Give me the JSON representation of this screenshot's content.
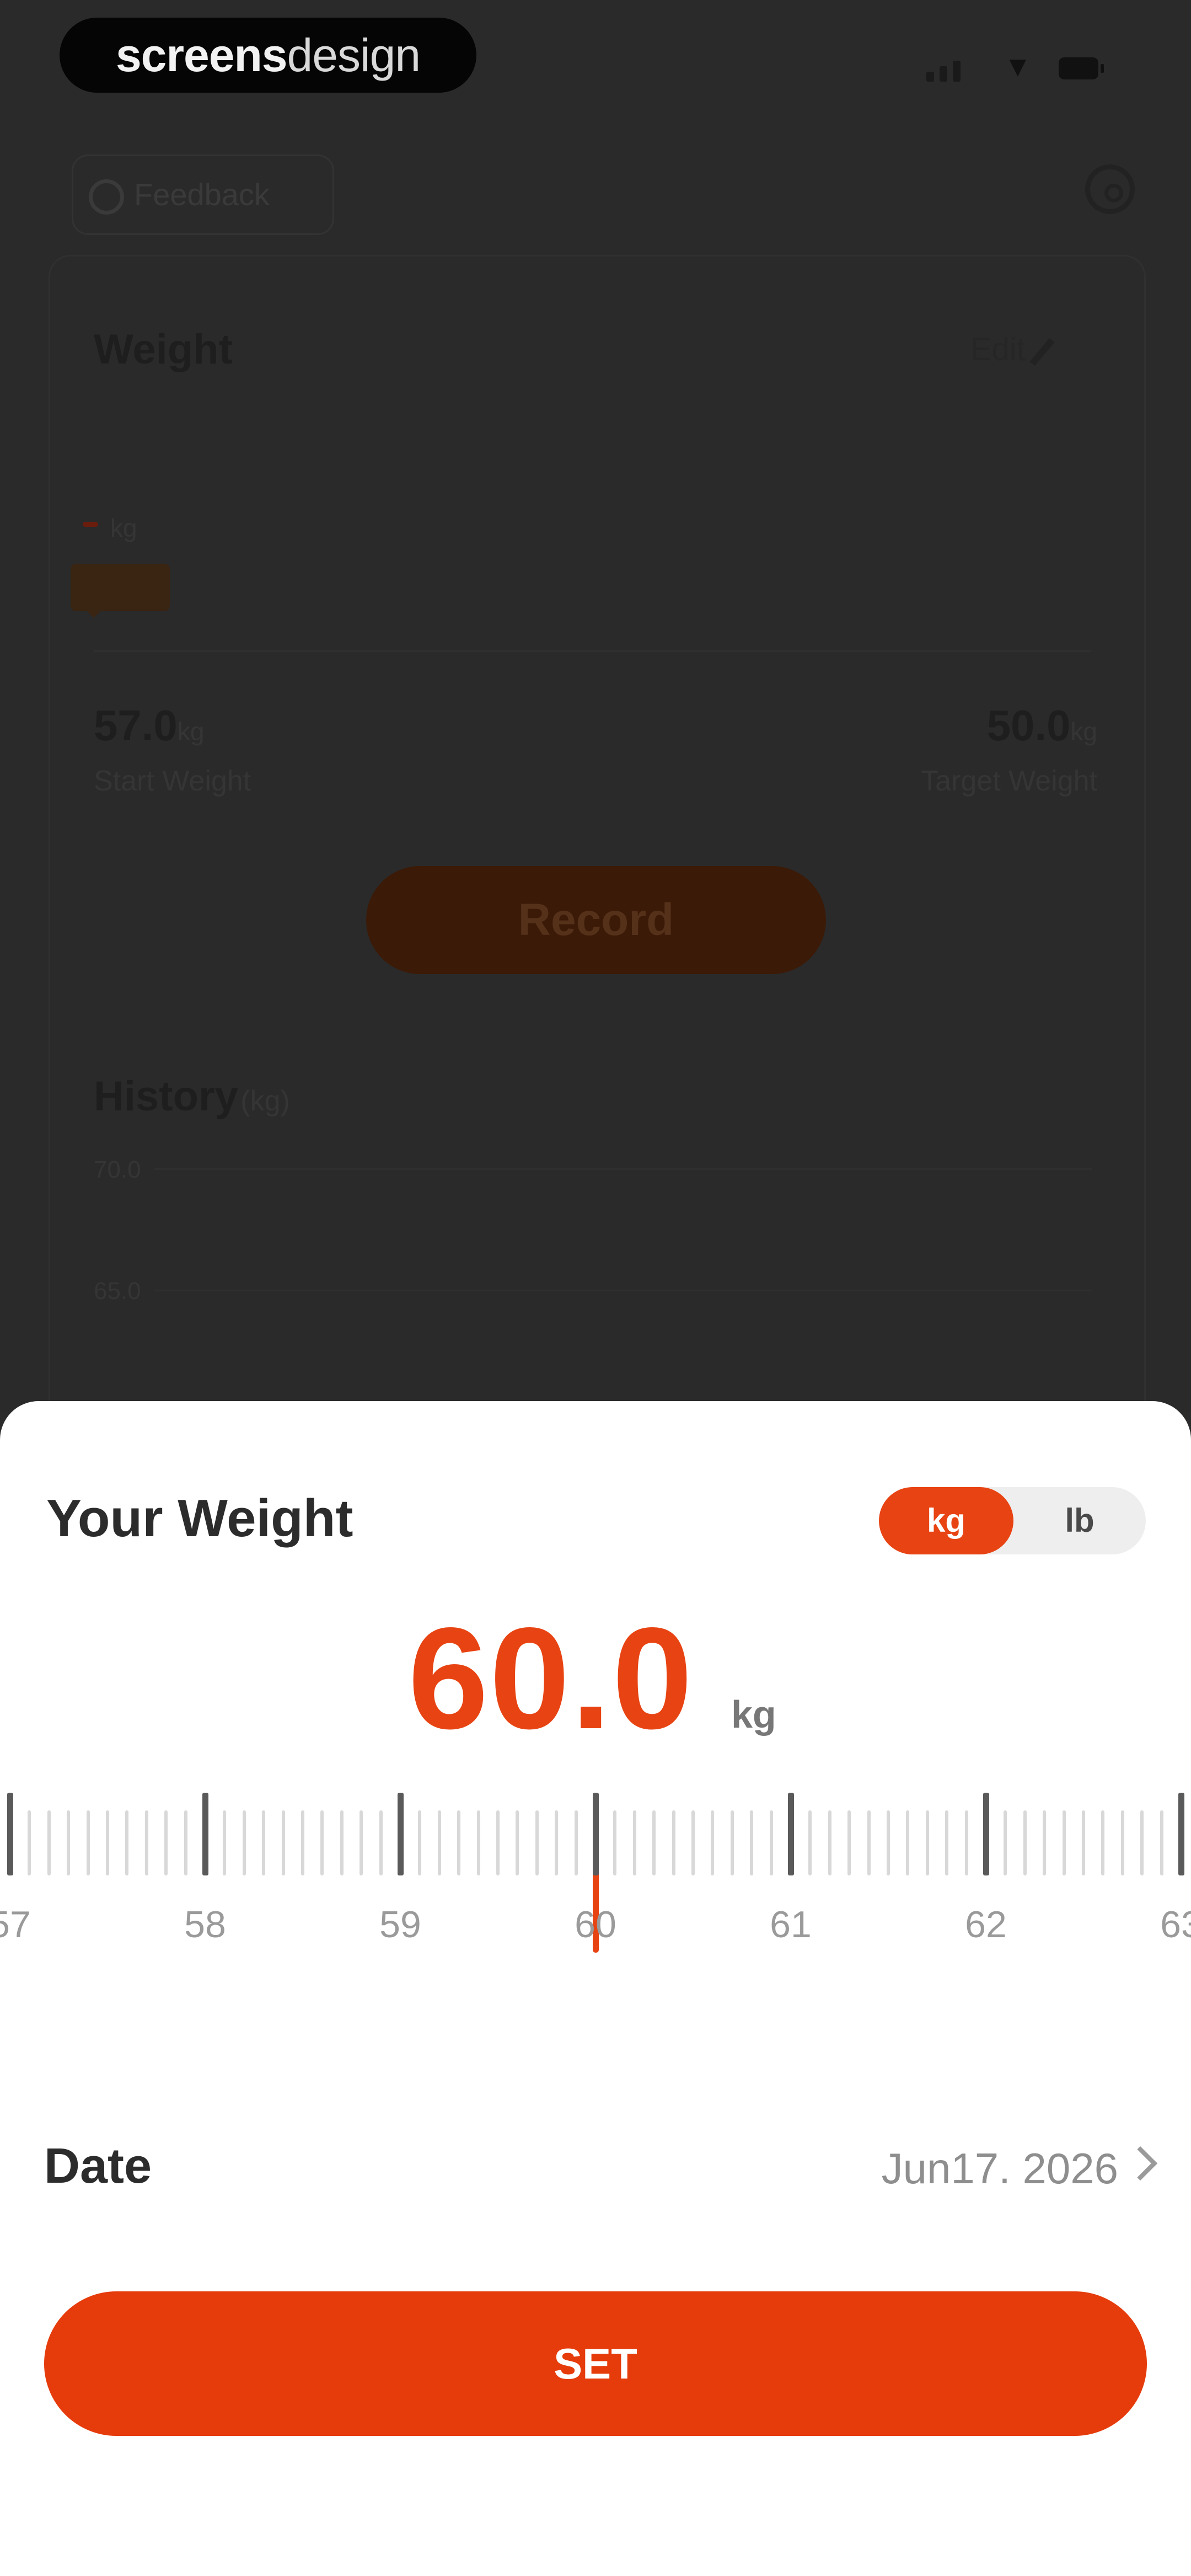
{
  "watermark": {
    "brand_bold": "screens",
    "brand_light": "design"
  },
  "background": {
    "feedback_label": "Feedback",
    "weight_title": "Weight",
    "edit_label": "Edit",
    "chart_unit": "kg",
    "start_weight": "57.0",
    "start_weight_unit": "kg",
    "start_weight_label": "Start Weight",
    "target_weight": "50.0",
    "target_weight_unit": "kg",
    "target_weight_label": "Target Weight",
    "record_label": "Record",
    "history_title": "History",
    "history_unit": "(kg)",
    "history_axis": [
      "70.0",
      "65.0"
    ]
  },
  "sheet": {
    "title": "Your Weight",
    "unit_options": [
      "kg",
      "lb"
    ],
    "selected_unit": "kg",
    "value": "60.0",
    "value_unit": "kg",
    "ruler_labels": [
      "57",
      "58",
      "59",
      "60",
      "61",
      "62",
      "63"
    ],
    "ruler_selected": 60.0,
    "date_label": "Date",
    "date_value": "Jun17. 2026",
    "set_label": "SET"
  },
  "colors": {
    "accent": "#e84312",
    "backdrop": "#2b2b2b",
    "sheet": "#ffffff"
  }
}
